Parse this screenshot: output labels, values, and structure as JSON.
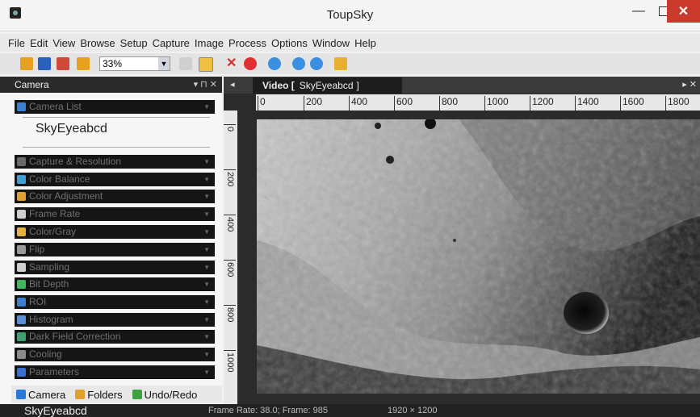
{
  "window": {
    "title": "ToupSky",
    "minimize": "—",
    "close": "✕"
  },
  "menu": [
    "File",
    "Edit",
    "View",
    "Browse",
    "Setup",
    "Capture",
    "Image",
    "Process",
    "Options",
    "Window",
    "Help"
  ],
  "toolbar": {
    "zoom": "33%"
  },
  "panel": {
    "title": "Camera",
    "controls": "▾ ⊓ ✕",
    "camera_list_label": "Camera List",
    "camera_name": "SkyEyeabcd",
    "sections": [
      {
        "label": "Capture & Resolution",
        "color": "#6a6a6a"
      },
      {
        "label": "Color Balance",
        "color": "#3fa0d8"
      },
      {
        "label": "Color Adjustment",
        "color": "#e0a030"
      },
      {
        "label": "Frame Rate",
        "color": "#cfcfcf"
      },
      {
        "label": "Color/Gray",
        "color": "#e6b040"
      },
      {
        "label": "Flip",
        "color": "#9a9a9a"
      },
      {
        "label": "Sampling",
        "color": "#d0d0d0"
      },
      {
        "label": "Bit Depth",
        "color": "#3fb860"
      },
      {
        "label": "ROI",
        "color": "#3a7fd0"
      },
      {
        "label": "Histogram",
        "color": "#5a8fd8"
      },
      {
        "label": "Dark Field Correction",
        "color": "#3fa070"
      },
      {
        "label": "Cooling",
        "color": "#8a8a8a"
      },
      {
        "label": "Parameters",
        "color": "#3a6fd0"
      }
    ],
    "tabs": [
      {
        "label": "Camera",
        "color": "#2a78d6"
      },
      {
        "label": "Folders",
        "color": "#e0a030"
      },
      {
        "label": "Undo/Redo",
        "color": "#3fa040"
      }
    ]
  },
  "video": {
    "tab_label": "Video [",
    "tab_camera": "SkyEyeabcd",
    "tab_close": "]",
    "ruler_h": [
      "0",
      "200",
      "400",
      "600",
      "800",
      "1000",
      "1200",
      "1400",
      "1600",
      "1800"
    ],
    "ruler_v": [
      "0",
      "200",
      "400",
      "600",
      "800",
      "1000"
    ]
  },
  "status": {
    "camera": "SkyEyeabcd",
    "frame": "Frame Rate: 38.0; Frame: 985",
    "resolution": "1920 × 1200"
  }
}
